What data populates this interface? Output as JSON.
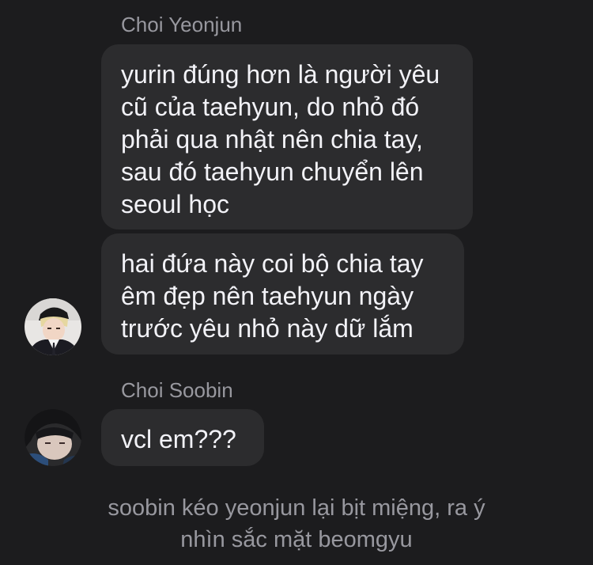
{
  "messages": {
    "group1": {
      "sender": "Choi Yeonjun",
      "bubble1": {
        "lines": [
          "yurin đúng hơn là người yêu",
          "cũ của taehyun, do nhỏ đó",
          "phải qua nhật nên chia tay,",
          "sau đó taehyun chuyển lên",
          "seoul học"
        ]
      },
      "bubble2": {
        "lines": [
          "hai đứa này coi bộ chia tay",
          "êm đẹp nên taehyun ngày",
          "trước yêu nhỏ này dữ lắm"
        ]
      }
    },
    "group2": {
      "sender": "Choi Soobin",
      "bubble1": {
        "lines": [
          "vcl em???"
        ]
      }
    }
  },
  "narration": {
    "lines": [
      "soobin kéo yeonjun lại bịt miệng, ra ý",
      "nhìn sắc mặt beomgyu"
    ]
  },
  "colors": {
    "background": "#1c1c1e",
    "bubble": "#2c2c2e",
    "text": "#f2f2f7",
    "secondary_text": "#98989f"
  }
}
